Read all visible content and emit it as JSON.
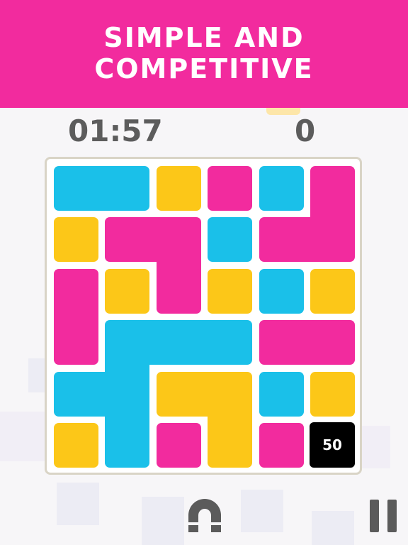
{
  "banner": {
    "line1": "SIMPLE AND",
    "line2": "COMPETITIVE"
  },
  "hud": {
    "timer": "01:57",
    "score": "0"
  },
  "board": {
    "rows": 6,
    "cols": 6,
    "colors": {
      "blue": "#1ac0e9",
      "yellow": "#fcc718",
      "pink": "#f22b9e"
    },
    "pieces": [
      {
        "color": "blue",
        "cells": [
          [
            0,
            0
          ],
          [
            0,
            1
          ]
        ]
      },
      {
        "color": "yellow",
        "cells": [
          [
            0,
            2
          ]
        ]
      },
      {
        "color": "pink",
        "cells": [
          [
            0,
            3
          ]
        ]
      },
      {
        "color": "blue",
        "cells": [
          [
            0,
            4
          ]
        ]
      },
      {
        "color": "pink",
        "cells": [
          [
            0,
            5
          ],
          [
            1,
            5
          ],
          [
            1,
            4
          ]
        ]
      },
      {
        "color": "yellow",
        "cells": [
          [
            1,
            0
          ]
        ]
      },
      {
        "color": "pink",
        "cells": [
          [
            1,
            1
          ],
          [
            1,
            2
          ],
          [
            2,
            2
          ]
        ]
      },
      {
        "color": "blue",
        "cells": [
          [
            1,
            3
          ]
        ]
      },
      {
        "color": "pink",
        "cells": [
          [
            2,
            0
          ],
          [
            3,
            0
          ]
        ]
      },
      {
        "color": "yellow",
        "cells": [
          [
            2,
            1
          ]
        ]
      },
      {
        "color": "yellow",
        "cells": [
          [
            2,
            3
          ]
        ]
      },
      {
        "color": "blue",
        "cells": [
          [
            2,
            4
          ]
        ]
      },
      {
        "color": "yellow",
        "cells": [
          [
            2,
            5
          ]
        ]
      },
      {
        "color": "blue",
        "cells": [
          [
            3,
            1
          ],
          [
            3,
            2
          ],
          [
            3,
            3
          ],
          [
            4,
            1
          ],
          [
            4,
            0
          ],
          [
            5,
            1
          ]
        ]
      },
      {
        "color": "pink",
        "cells": [
          [
            3,
            4
          ],
          [
            3,
            5
          ]
        ]
      },
      {
        "color": "yellow",
        "cells": [
          [
            4,
            2
          ],
          [
            4,
            3
          ],
          [
            5,
            3
          ]
        ]
      },
      {
        "color": "blue",
        "cells": [
          [
            4,
            4
          ]
        ]
      },
      {
        "color": "yellow",
        "cells": [
          [
            4,
            5
          ]
        ]
      },
      {
        "color": "yellow",
        "cells": [
          [
            5,
            0
          ]
        ]
      },
      {
        "color": "pink",
        "cells": [
          [
            5,
            2
          ]
        ]
      },
      {
        "color": "pink",
        "cells": [
          [
            5,
            4
          ]
        ]
      }
    ],
    "badge_cell": {
      "row": 5,
      "col": 5,
      "label": "50"
    }
  },
  "controls": {
    "magnet": "magnet-icon",
    "pause": "pause-icon"
  }
}
